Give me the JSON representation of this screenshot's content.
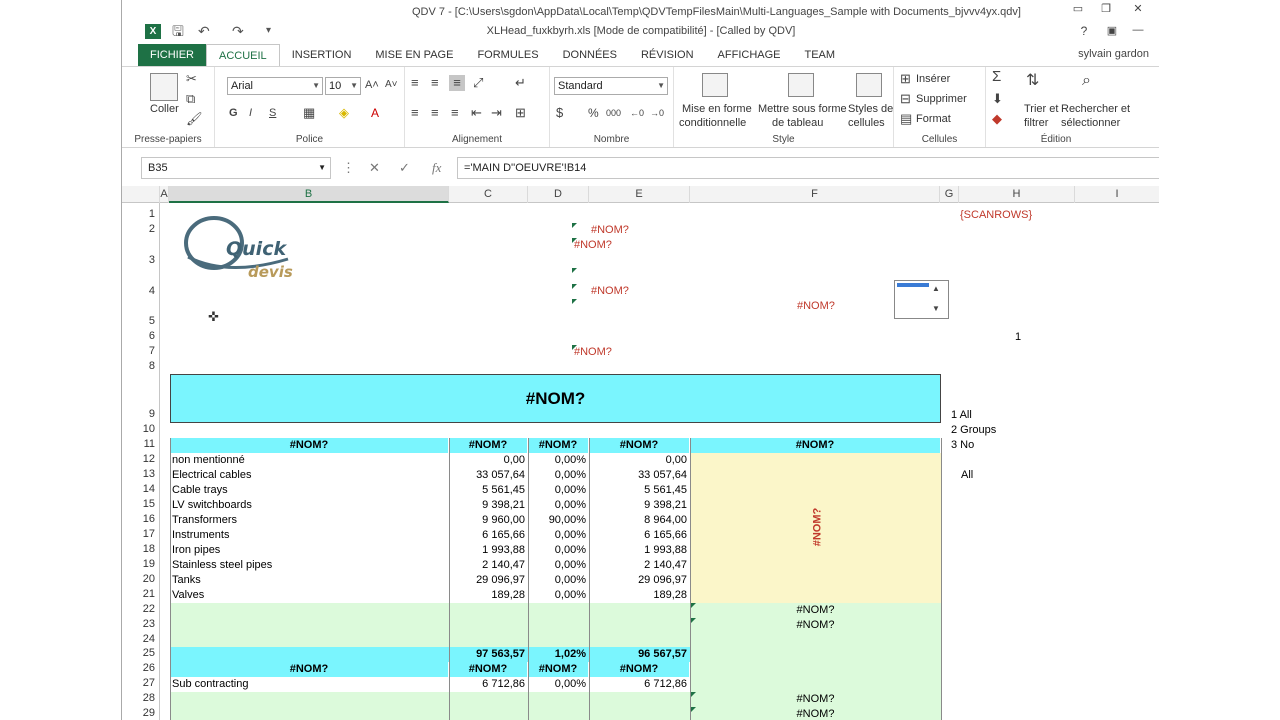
{
  "window": {
    "title": "XLHead_fuxkbyrh.xls  [Mode de compatibilité] - [Called by QDV]",
    "top_title": "QDV 7 - [C:\\Users\\sgdon\\AppData\\Local\\Temp\\QDVTempFilesMain\\Multi-Languages_Sample with Documents_bjvvv4yx.qdv]",
    "user": "sylvain gardon",
    "help": "?"
  },
  "tabs": [
    "FICHIER",
    "ACCUEIL",
    "INSERTION",
    "MISE EN PAGE",
    "FORMULES",
    "DONNÉES",
    "RÉVISION",
    "AFFICHAGE",
    "TEAM"
  ],
  "ribbon": {
    "clipboard": {
      "paste": "Coller",
      "label": "Presse-papiers"
    },
    "font": {
      "name": "Arial",
      "size": "10",
      "label": "Police",
      "bold": "G",
      "italic": "I",
      "underline": "S"
    },
    "alignment": {
      "label": "Alignement"
    },
    "number": {
      "format": "Standard",
      "label": "Nombre",
      "percent": "%",
      "thousands": "000"
    },
    "style": {
      "cond_l1": "Mise en forme",
      "cond_l2": "conditionnelle",
      "table_l1": "Mettre sous forme",
      "table_l2": "de tableau",
      "cell_l1": "Styles de",
      "cell_l2": "cellules",
      "label": "Style"
    },
    "cells": {
      "insert": "Insérer",
      "delete": "Supprimer",
      "format": "Format",
      "label": "Cellules"
    },
    "edit": {
      "sort_l1": "Trier et",
      "sort_l2": "filtrer",
      "find_l1": "Rechercher et",
      "find_l2": "sélectionner",
      "label": "Édition"
    }
  },
  "formula_bar": {
    "name_box": "B35",
    "formula": "='MAIN D''OEUVRE'!B14",
    "fx": "fx"
  },
  "columns": [
    "A",
    "B",
    "C",
    "D",
    "E",
    "F",
    "G",
    "H",
    "I"
  ],
  "rows": [
    "1",
    "2",
    "3",
    "4",
    "5",
    "6",
    "7",
    "8",
    "9",
    "10",
    "11",
    "12",
    "13",
    "14",
    "15",
    "16",
    "17",
    "18",
    "19",
    "20",
    "21",
    "22",
    "23",
    "24",
    "25",
    "26",
    "27",
    "28",
    "29"
  ],
  "logo": {
    "l1": "Quick",
    "l2": "devis"
  },
  "sheet": {
    "err": "#NOM?",
    "scanrows": "{SCANROWS}",
    "h6": "1",
    "outline": [
      "1 All",
      "2 Groups",
      "3 No"
    ],
    "h13": "All",
    "items": [
      {
        "label": "non mentionné",
        "c": "0,00",
        "d": "0,00%",
        "e": "0,00"
      },
      {
        "label": "Electrical cables",
        "c": "33 057,64",
        "d": "0,00%",
        "e": "33 057,64"
      },
      {
        "label": "Cable trays",
        "c": "5 561,45",
        "d": "0,00%",
        "e": "5 561,45"
      },
      {
        "label": "LV switchboards",
        "c": "9 398,21",
        "d": "0,00%",
        "e": "9 398,21"
      },
      {
        "label": "Transformers",
        "c": "9 960,00",
        "d": "90,00%",
        "e": "8 964,00"
      },
      {
        "label": "Instruments",
        "c": "6 165,66",
        "d": "0,00%",
        "e": "6 165,66"
      },
      {
        "label": "Iron pipes",
        "c": "1 993,88",
        "d": "0,00%",
        "e": "1 993,88"
      },
      {
        "label": "Stainless steel pipes",
        "c": "2 140,47",
        "d": "0,00%",
        "e": "2 140,47"
      },
      {
        "label": "Tanks",
        "c": "29 096,97",
        "d": "0,00%",
        "e": "29 096,97"
      },
      {
        "label": "Valves",
        "c": "189,28",
        "d": "0,00%",
        "e": "189,28"
      }
    ],
    "total": {
      "c": "97 563,57",
      "d": "1,02%",
      "e": "96 567,57"
    },
    "sub": {
      "label": "Sub contracting",
      "c": "6 712,86",
      "d": "0,00%",
      "e": "6 712,86"
    }
  },
  "colors": {
    "accent": "#1e7145",
    "header_cyan": "#7af5fe",
    "green_fill": "#dcfadb",
    "yellow_fill": "#fbf6c9",
    "error_red": "#c0392b"
  }
}
